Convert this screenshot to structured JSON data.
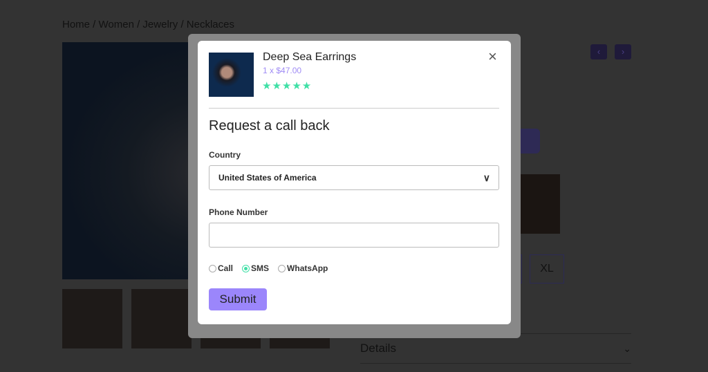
{
  "breadcrumb": "Home / Women / Jewelry / Necklaces",
  "nav": {
    "prev": "‹",
    "next": "›"
  },
  "sizes": [
    "XL"
  ],
  "details_label": "Details",
  "modal": {
    "product_name": "Deep Sea Earrings",
    "price": "1 x $47.00",
    "rating": 5,
    "stars": "★★★★★",
    "close": "×",
    "title": "Request a call back",
    "country_label": "Country",
    "country_value": "United States of America",
    "phone_label": "Phone Number",
    "phone_value": "",
    "contact_options": [
      {
        "label": "Call",
        "selected": false
      },
      {
        "label": "SMS",
        "selected": true
      },
      {
        "label": "WhatsApp",
        "selected": false
      }
    ],
    "submit": "Submit"
  },
  "colors": {
    "accent": "#9b86fb",
    "stars": "#3fe0a6",
    "price": "#a08cf5"
  }
}
